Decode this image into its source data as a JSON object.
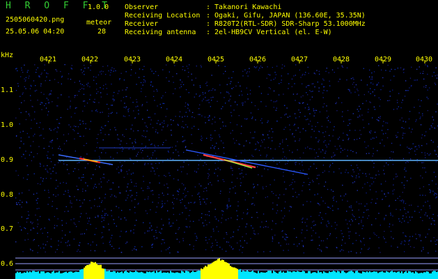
{
  "header": {
    "app_name": "H R O F F T",
    "version": "1.0.0",
    "filename": "2505060420.png",
    "datetime": "25.05.06 04:20",
    "meteor_label": "meteor",
    "meteor_count": "28",
    "info_keys": [
      "Observer",
      "Receiving Location",
      "Receiver",
      "Receiving antenna"
    ],
    "info_values": [
      ": Takanori Kawachi",
      ": Ogaki, Gifu, JAPAN (136.60E, 35.35N)",
      ": R820T2(RTL-SDR) SDR-Sharp 53.1000MHz",
      ": 2el-HB9CV Vertical (el. E-W)"
    ]
  },
  "spectrogram": {
    "y_unit": "kHz",
    "y_ticks": [
      "1.1",
      "1.0",
      "0.9",
      "0.8",
      "0.7",
      "0.6"
    ],
    "x_ticks": [
      "0421",
      "0422",
      "0423",
      "0424",
      "0425",
      "0426",
      "0427",
      "0428",
      "0429",
      "0430"
    ],
    "colors": {
      "background": "#000000",
      "noise": "#0a1a8c",
      "carrier": "#5fb4ff",
      "axis_text": "#ffff00",
      "header_text": "#33cc33",
      "histogram_cyan": "#00e5ff",
      "histogram_yellow": "#ffff00"
    }
  }
}
